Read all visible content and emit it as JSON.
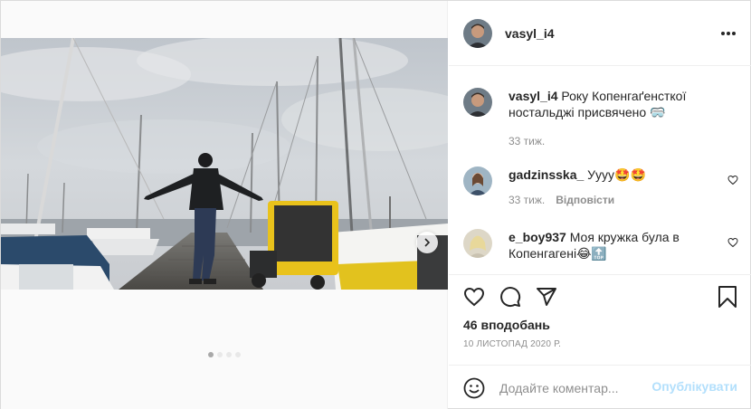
{
  "post": {
    "author": {
      "username": "vasyl_i4"
    },
    "caption": {
      "username": "vasyl_i4",
      "text": "Року Копенгаґенсткої ностальджі присвячено",
      "emoji": "🥽",
      "time": "33 тиж."
    },
    "comments": [
      {
        "username": "gadzinsska_",
        "text": "Уууу",
        "emoji": "🤩🤩",
        "time": "33 тиж.",
        "reply_label": "Відповісти"
      },
      {
        "username": "e_boy937",
        "text": "Моя кружка була в Копенгагені",
        "emoji": "😂🔝"
      }
    ],
    "likes": "46 вподобань",
    "date": "10 ЛИСТОПАД 2020 Р.",
    "add_comment": {
      "placeholder": "Додайте коментар...",
      "publish_label": "Опублікувати"
    },
    "carousel": {
      "slide_count": 4,
      "active_index": 0
    }
  },
  "icons": {
    "more": "more-options-icon",
    "like": "heart-icon",
    "comment": "comment-icon",
    "share": "share-icon",
    "save": "bookmark-icon",
    "emoji": "smiley-icon",
    "next": "chevron-right-icon"
  },
  "colors": {
    "text": "#262626",
    "muted": "#8e8e8e",
    "border": "#dbdbdb",
    "publish_disabled": "#b2dffc"
  }
}
